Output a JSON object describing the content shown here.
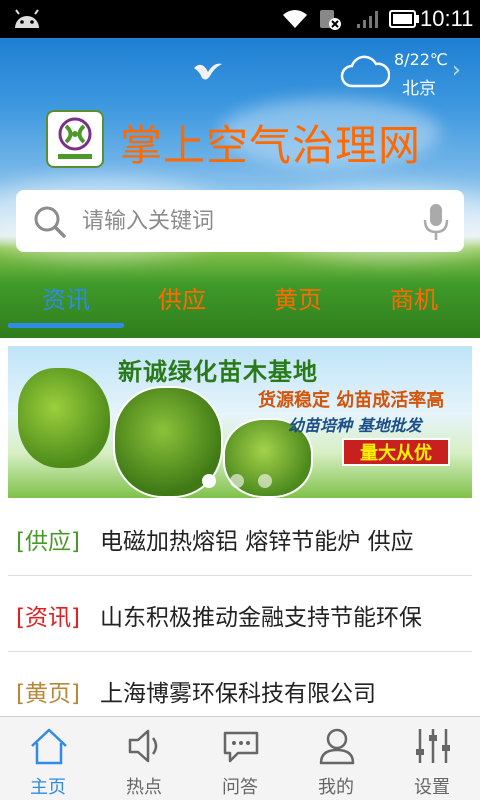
{
  "status_bar": {
    "time": "10:11"
  },
  "weather": {
    "temp": "8/22℃",
    "city": "北京",
    "icon": "cloud-icon"
  },
  "app": {
    "title": "掌上空气治理网"
  },
  "search": {
    "placeholder": "请输入关键词"
  },
  "tabs": [
    {
      "label": "资讯",
      "active": true
    },
    {
      "label": "供应",
      "active": false
    },
    {
      "label": "黄页",
      "active": false
    },
    {
      "label": "商机",
      "active": false
    }
  ],
  "banner": {
    "title": "新诚绿化苗木基地",
    "line1": "货源稳定 幼苗成活率高",
    "line2": "幼苗培种  基地批发",
    "badge": "量大从优",
    "page_count": 3,
    "current_page": 1
  },
  "news": [
    {
      "category": "[供应]",
      "category_color": "#4a9a2a",
      "text": "电磁加热熔铝 熔锌节能炉 供应"
    },
    {
      "category": "[资讯]",
      "category_color": "#e02020",
      "text": "山东积极推动金融支持节能环保"
    },
    {
      "category": "[黄页]",
      "category_color": "#b8883a",
      "text": "上海博雾环保科技有限公司"
    }
  ],
  "bottom_nav": [
    {
      "label": "主页",
      "icon": "home-icon",
      "active": true
    },
    {
      "label": "热点",
      "icon": "speaker-icon",
      "active": false
    },
    {
      "label": "问答",
      "icon": "chat-icon",
      "active": false
    },
    {
      "label": "我的",
      "icon": "user-icon",
      "active": false
    },
    {
      "label": "设置",
      "icon": "settings-sliders-icon",
      "active": false
    }
  ],
  "colors": {
    "accent": "#2f8be6",
    "title_orange": "#ff6a00"
  }
}
